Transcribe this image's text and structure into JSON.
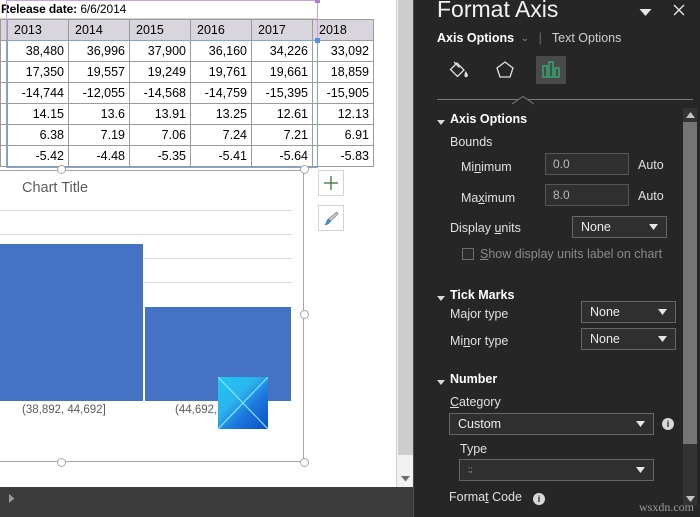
{
  "worksheet": {
    "banner": {
      "label": "Release date:",
      "value": "6/6/2014"
    },
    "table": {
      "headers": [
        "2013",
        "2014",
        "2015",
        "2016",
        "2017",
        "2018"
      ],
      "rows": [
        [
          "38,480",
          "36,996",
          "37,900",
          "36,160",
          "34,226",
          "33,092"
        ],
        [
          "17,350",
          "19,557",
          "19,249",
          "19,761",
          "19,661",
          "18,859"
        ],
        [
          "-14,744",
          "-12,055",
          "-14,568",
          "-14,759",
          "-15,395",
          "-15,905"
        ],
        [
          "14.15",
          "13.6",
          "13.91",
          "13.25",
          "12.61",
          "12.13"
        ],
        [
          "6.38",
          "7.19",
          "7.06",
          "7.24",
          "7.21",
          "6.91"
        ],
        [
          "-5.42",
          "-4.48",
          "-5.35",
          "-5.41",
          "-5.64",
          "-5.83"
        ]
      ]
    },
    "scroll": {
      "vertical_down_arrow": "▼",
      "horizontal_right_arrow": "▶"
    }
  },
  "chart": {
    "title": "Chart Title",
    "elements_button": "+",
    "styles_button": "paintbrush",
    "chart_data": {
      "type": "bar",
      "title": "Chart Title",
      "xlabel": "",
      "ylabel": "",
      "categories": [
        "(38,892, 44,692]",
        "(44,692, 50,492]"
      ],
      "values": [
        6.6,
        4.0
      ],
      "ylim": [
        0,
        8
      ],
      "yticks": [
        0,
        1,
        2,
        3,
        4,
        5,
        6,
        7,
        8
      ],
      "grid": true,
      "legend": "none",
      "bar_color": "#4472C4",
      "note": "Histogram; y-axis tick labels hidden (custom number format ;;)"
    }
  },
  "pane": {
    "title": "Format Axis",
    "dropdown_icon": "chevron-down-icon",
    "close_icon": "close-icon",
    "tabs": {
      "active": "Axis Options",
      "caret": "⌄",
      "separator": "|",
      "inactive": "Text Options"
    },
    "icons": [
      {
        "name": "fill-icon",
        "selected": false
      },
      {
        "name": "effects-pentagon-icon",
        "selected": false
      },
      {
        "name": "axis-options-bar-chart-icon",
        "selected": true
      }
    ],
    "sections": {
      "axis_options": {
        "heading": "Axis Options",
        "bounds_label": "Bounds",
        "minimum": {
          "label_pre": "Mi",
          "label_key": "n",
          "label_post": "imum",
          "value": "0.0",
          "auto": "Auto"
        },
        "maximum": {
          "label_pre": "Ma",
          "label_key": "x",
          "label_post": "imum",
          "value": "8.0",
          "auto": "Auto"
        },
        "display_units": {
          "label_pre": "Display ",
          "label_key": "u",
          "label_post": "nits",
          "value": "None"
        },
        "show_units_checkbox": {
          "label_key": "S",
          "label_post": "how display units label on chart",
          "checked": false
        }
      },
      "tick_marks": {
        "heading": "Tick Marks",
        "major_type": {
          "label": "Major type",
          "value": "None"
        },
        "minor_type": {
          "label_pre": "Mi",
          "label_key": "n",
          "label_post": "or type",
          "value": "None"
        }
      },
      "number": {
        "heading": "Number",
        "category": {
          "label_key": "C",
          "label_post": "ategory",
          "value": "Custom"
        },
        "type": {
          "label": "Type",
          "value": ";;"
        },
        "format_code": {
          "label_pre": "Forma",
          "label_key": "t",
          "label_post": " Code"
        }
      }
    },
    "scroll": {
      "up_arrow": "▲",
      "down_arrow": "▼"
    }
  },
  "watermark": "wsxdn.com"
}
